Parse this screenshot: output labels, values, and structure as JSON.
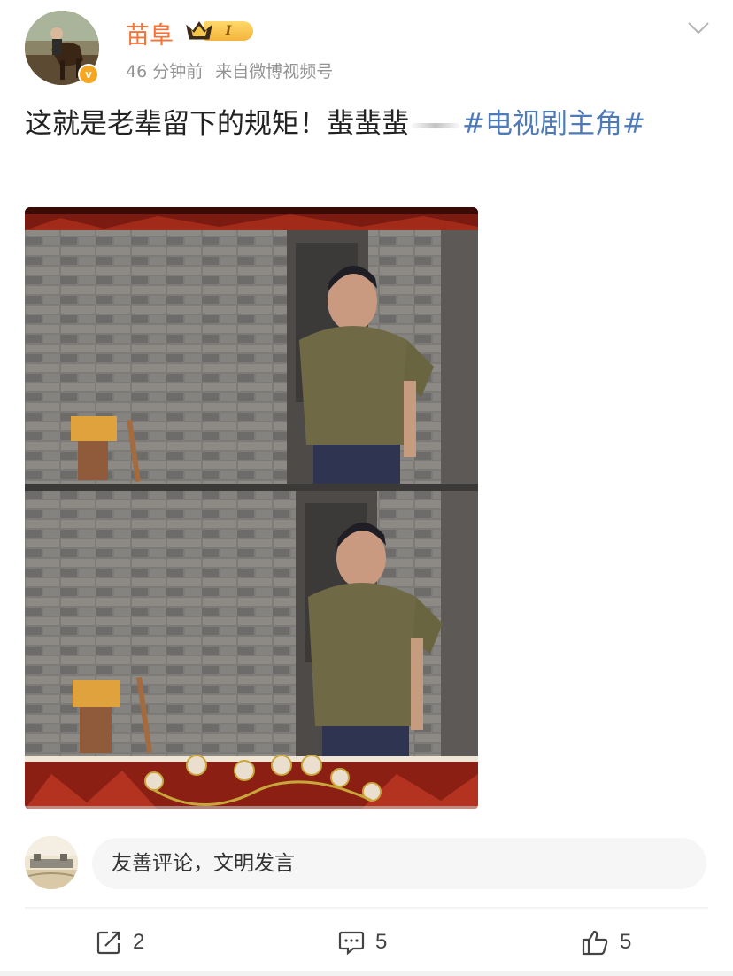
{
  "post": {
    "author": {
      "name": "苗阜",
      "vip_level": "I",
      "verified_icon": "verified-v-badge",
      "crown_icon": "crown-icon"
    },
    "time": "46 分钟前",
    "source": "来自微博视频号",
    "text_main": "这就是老辈留下的规矩！蜚蜚蜚",
    "hashtag": "#电视剧主角#",
    "media": {
      "type": "video-thumbnail",
      "frames": 2
    }
  },
  "comment_bar": {
    "placeholder": "友善评论，文明发言"
  },
  "actions": {
    "repost_count": "2",
    "comment_count": "5",
    "like_count": "5"
  },
  "colors": {
    "username": "#f77234",
    "hashtag": "#4f7ab8",
    "meta": "#939393",
    "vip_gold": "#f4b53c"
  }
}
